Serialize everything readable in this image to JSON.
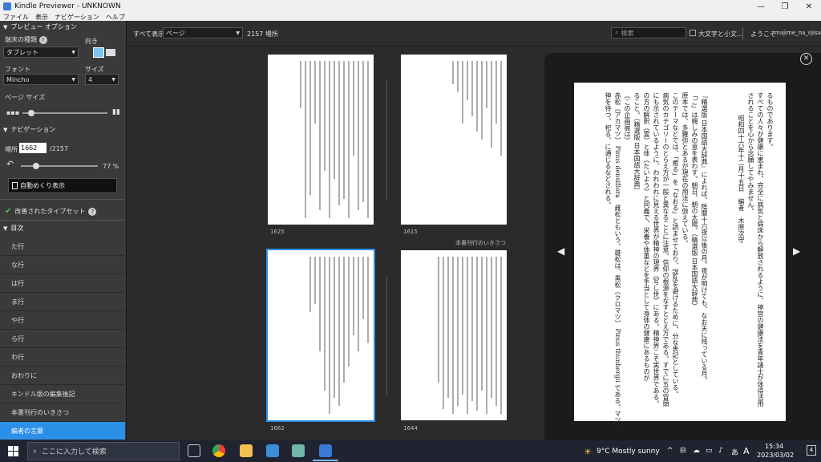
{
  "window": {
    "title": "Kindle Previewer - UNKNOWN",
    "controls": [
      "—",
      "❐",
      "✕"
    ]
  },
  "menu": [
    "ファイル",
    "表示",
    "ナビゲーション",
    "ヘルプ"
  ],
  "left": {
    "preview_options": "プレビュー オプション",
    "device_type_label": "端末の種類",
    "device_type_value": "タブレット",
    "orientation_label": "向き",
    "font_label": "フォント",
    "font_value": "Mincho",
    "size_label": "サイズ",
    "size_value": "4",
    "page_size_label": "ページ サイズ",
    "page_size_fraction": 0.1,
    "navigation": "ナビゲーション",
    "location_label": "場所",
    "location_value": "1662",
    "location_total": "/2157",
    "progress_value": "77 %",
    "progress_fraction": 0.2,
    "autoflip": "自動めくり表示",
    "typeset": "改善されたタイプセット",
    "toc_header": "目次",
    "toc": [
      "た行",
      "な行",
      "は行",
      "ま行",
      "や行",
      "ら行",
      "わ行",
      "おわりに",
      "キンドル版の編集後記",
      "本書刊行のいきさつ",
      "編者の言葉"
    ]
  },
  "toolbar": {
    "show_all": "すべて表示",
    "view_value": "ページ",
    "location_count": "2157 場所",
    "search_placeholder": "検索",
    "case_label": "大文字と小文...",
    "welcome": "ようこそ",
    "user": "majime_na_ojisan"
  },
  "thumbs": {
    "labels": [
      "1625",
      "1615",
      "1662",
      "1644"
    ],
    "section_title": "本書刊行のいきさつ"
  },
  "reader": {
    "columns": [
      "るものであります。",
      "すべての人々が健康に恵まれ、完全に病気と病床から解放されるように、神宮の健康法を青年諸士が体得活用",
      "されることを心から念願してやみません。",
      "昭和四十六年十二月十五日　編者　木原次守",
      "",
      "『精選版 日本国語大辞典』によれば、陰暦十六夜以後の月。夜が明けても、なお天に残っている月。",
      "「ご」は親しみの意を表わす。朝日、朝の太陽。（精選版 日本国語大辞典）",
      "原本では、多羅弥とあるが現在の用法に倣えている。",
      "このテーマなどでは、「癒る」を「なおる」と読ませており、誤乱を避けるために、分な表記としている。",
      "病気のカテゴリーのとらえ方が一般と異なることに注意。信仰の根源をなすととえ方である。すでに五の冒頭",
      "にも示されているように、われわれに見える世界が精神の現界（写し世）にある。精神界こそ実世界である。",
      "の方の解釈（霊）と体（たいよう）と同義で、栄養や体重などを手当として身体の健康にあるものが",
      "ること。（精選版 日本国語大辞典）",
      "（この企画展は）",
      "赤松（アカマツ） Pinus densiflora　雌松ともいう。雄松は、黒松（クロマツ） Pinus thunbergii である。マツは",
      "神を待つ、祀る、に通じるなどされる。"
    ]
  },
  "taskbar": {
    "search_placeholder": "ここに入力して検索",
    "weather": "9°C  Mostly sunny",
    "time": "15:34",
    "date": "2023/03/02",
    "ime": "A"
  }
}
